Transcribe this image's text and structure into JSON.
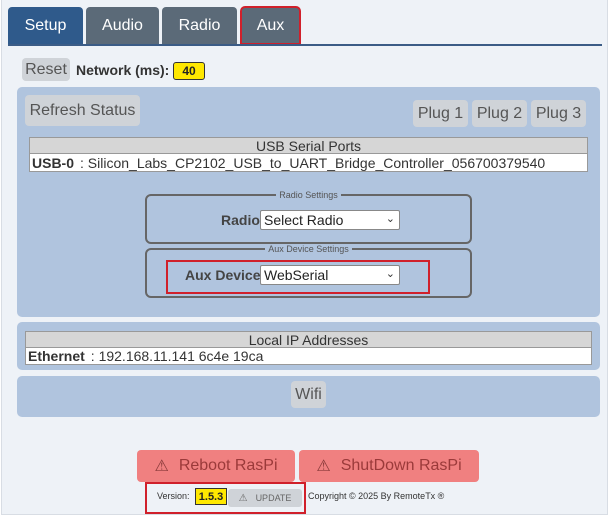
{
  "tabs": [
    {
      "label": "Setup"
    },
    {
      "label": "Audio"
    },
    {
      "label": "Radio"
    },
    {
      "label": "Aux"
    }
  ],
  "network": {
    "reset_label": "Reset",
    "label": "Network (ms):",
    "value": "40"
  },
  "status_panel": {
    "refresh_label": "Refresh Status",
    "plugs": [
      "Plug 1",
      "Plug 2",
      "Plug 3"
    ],
    "usb_header": "USB Serial Ports",
    "usb_rows": [
      {
        "name": "USB-0",
        "value": ": Silicon_Labs_CP2102_USB_to_UART_Bridge_Controller_056700379540"
      }
    ],
    "radio_settings": {
      "legend": "Radio Settings",
      "label": "Radio",
      "selected": "Select Radio"
    },
    "aux_settings": {
      "legend": "Aux Device Settings",
      "label": "Aux Device",
      "selected": "WebSerial"
    }
  },
  "ip_panel": {
    "header": "Local IP Addresses",
    "rows": [
      {
        "name": "Ethernet",
        "value": ": 192.168.11.141 6c4e 19ca"
      }
    ]
  },
  "wifi": {
    "label": "Wifi"
  },
  "actions": {
    "reboot_label": "Reboot RasPi",
    "shutdown_label": "ShutDown RasPi"
  },
  "footer": {
    "version_label": "Version:",
    "version": "1.5.3",
    "update_label": "UPDATE",
    "copyright": "Copyright © 2025 By RemoteTx ®"
  },
  "colors": {
    "active_tab": "#2f5a8b",
    "inactive_tab": "#5b6a78",
    "panel": "#b0c4de",
    "highlight": "#d0202b",
    "badge": "#ffe800",
    "danger": "#f08080"
  }
}
